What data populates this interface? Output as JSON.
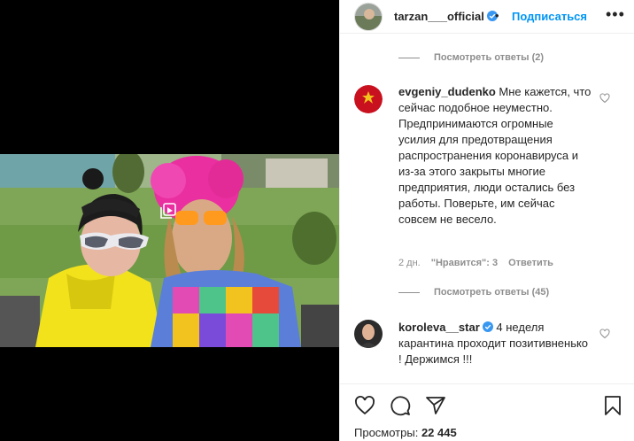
{
  "post": {
    "username": "tarzan___official",
    "separator": "•",
    "follow_label": "Подписаться",
    "more_label": "•••"
  },
  "comments": {
    "replies_1": "Посмотреть ответы (2)",
    "c1": {
      "username": "evgeniy_dudenko",
      "text": " Мне кажется, что сейчас подобное неуместно. Предпринимаются огромные усилия для предотвращения распространения коронавируса и из-за этого закрыты многие предприятия, люди остались без работы. Поверьте, им сейчас совсем не весело.",
      "time": "2 дн.",
      "likes": "\"Нравится\": 3",
      "reply": "Ответить"
    },
    "replies_2": "Посмотреть ответы (45)",
    "c2": {
      "username": "koroleva__star",
      "text": " 4 неделя карантина проходит позитивненько ! Держимся !!!"
    }
  },
  "footer": {
    "views_label": "Просмотры:",
    "views_count": "22 445"
  },
  "icons": {
    "verified": "verified-badge-icon",
    "like": "heart-icon",
    "comment": "comment-bubble-icon",
    "share": "paper-plane-icon",
    "save": "bookmark-icon",
    "video": "video-gallery-icon"
  },
  "colors": {
    "link_blue": "#0095f6",
    "muted": "#8e8e8e",
    "border": "#efefef",
    "verified_blue": "#3897f0"
  }
}
